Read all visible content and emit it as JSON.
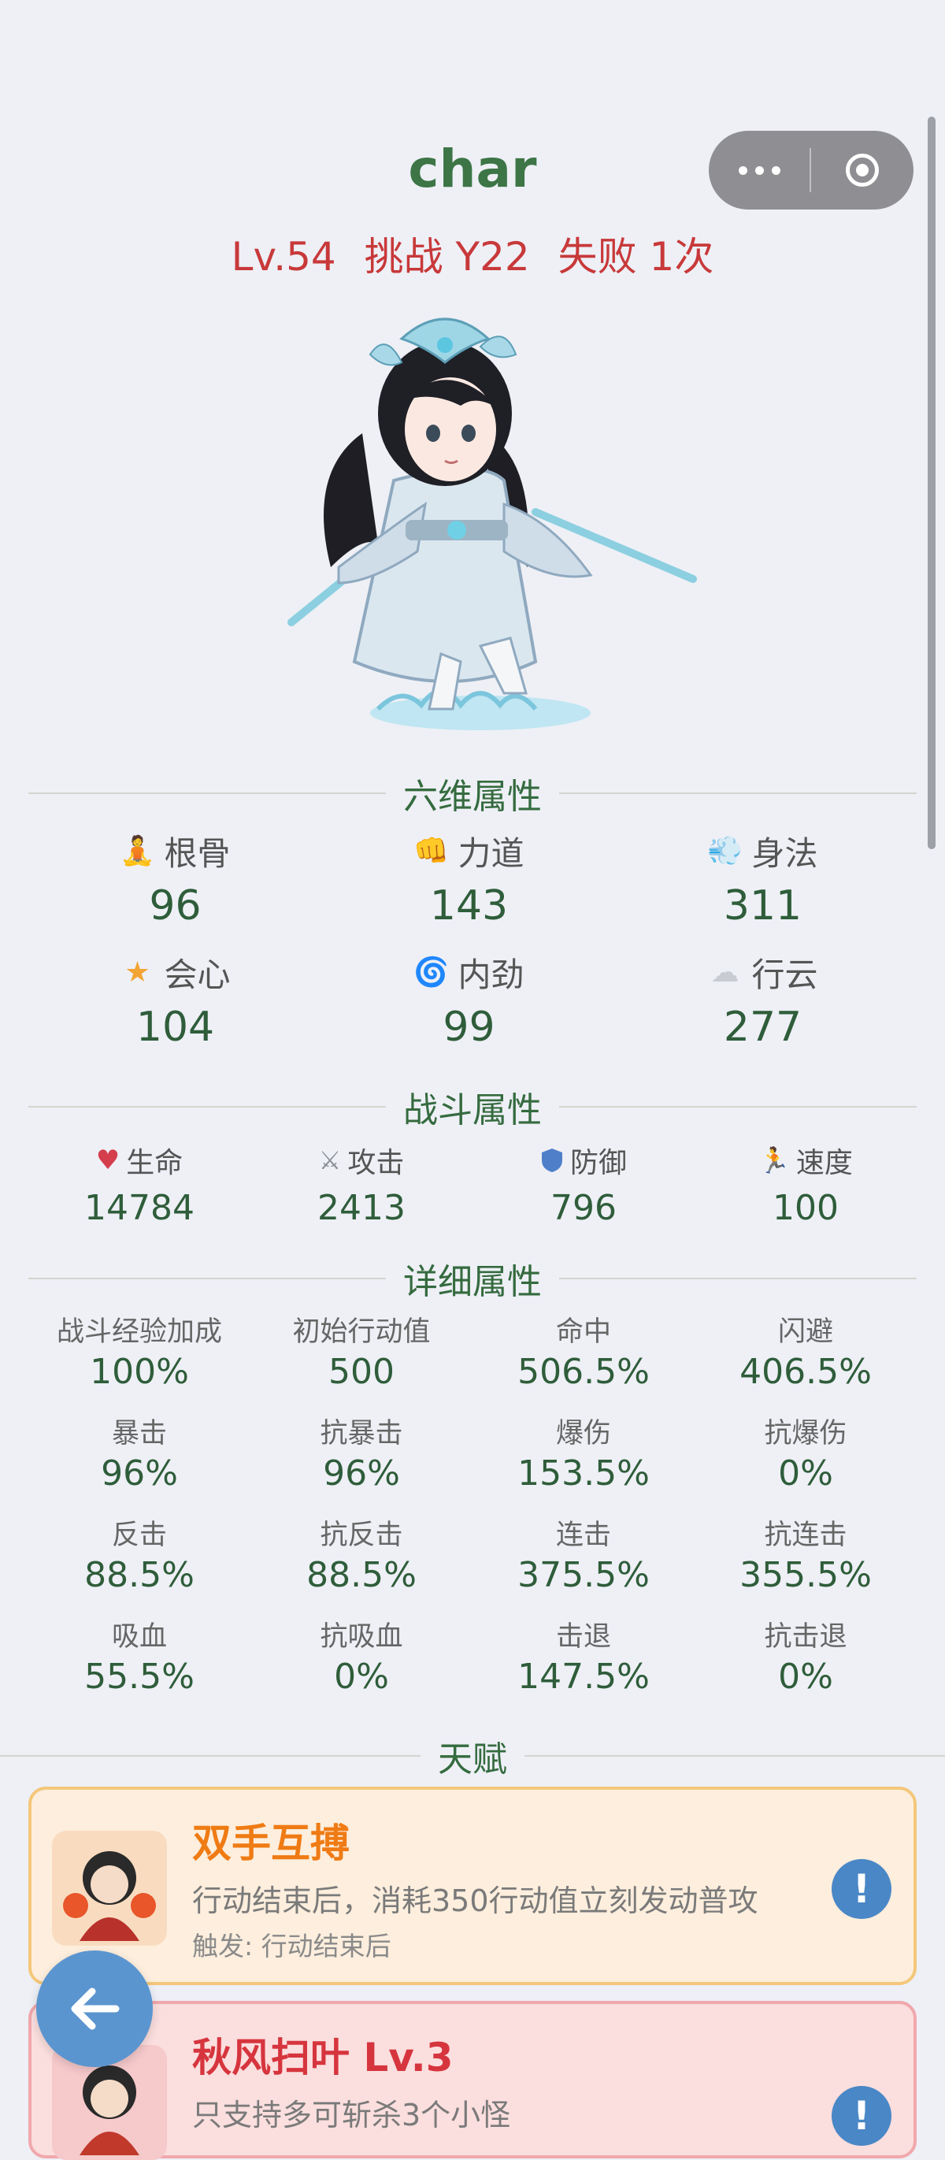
{
  "capsule": {
    "more_icon": "more-dots-icon",
    "close_icon": "target-close-icon"
  },
  "character": {
    "name": "char",
    "level": "Lv.54",
    "challenge": "挑战 Y22",
    "failures": "失败 1次"
  },
  "six_dim": {
    "title": "六维属性",
    "items": [
      {
        "label": "根骨",
        "value": "96",
        "icon": "meditation-icon"
      },
      {
        "label": "力道",
        "value": "143",
        "icon": "fist-icon"
      },
      {
        "label": "身法",
        "value": "311",
        "icon": "wind-icon"
      },
      {
        "label": "会心",
        "value": "104",
        "icon": "star-icon"
      },
      {
        "label": "内劲",
        "value": "99",
        "icon": "swirl-icon"
      },
      {
        "label": "行云",
        "value": "277",
        "icon": "cloud-icon"
      }
    ]
  },
  "battle": {
    "title": "战斗属性",
    "items": [
      {
        "label": "生命",
        "value": "14784",
        "icon": "heart-icon"
      },
      {
        "label": "攻击",
        "value": "2413",
        "icon": "crossed-swords-icon"
      },
      {
        "label": "防御",
        "value": "796",
        "icon": "shield-icon"
      },
      {
        "label": "速度",
        "value": "100",
        "icon": "runner-icon"
      }
    ]
  },
  "detail": {
    "title": "详细属性",
    "items": [
      {
        "label": "战斗经验加成",
        "value": "100%"
      },
      {
        "label": "初始行动值",
        "value": "500"
      },
      {
        "label": "命中",
        "value": "506.5%"
      },
      {
        "label": "闪避",
        "value": "406.5%"
      },
      {
        "label": "暴击",
        "value": "96%"
      },
      {
        "label": "抗暴击",
        "value": "96%"
      },
      {
        "label": "爆伤",
        "value": "153.5%"
      },
      {
        "label": "抗爆伤",
        "value": "0%"
      },
      {
        "label": "反击",
        "value": "88.5%"
      },
      {
        "label": "抗反击",
        "value": "88.5%"
      },
      {
        "label": "连击",
        "value": "375.5%"
      },
      {
        "label": "抗连击",
        "value": "355.5%"
      },
      {
        "label": "吸血",
        "value": "55.5%"
      },
      {
        "label": "抗吸血",
        "value": "0%"
      },
      {
        "label": "击退",
        "value": "147.5%"
      },
      {
        "label": "抗击退",
        "value": "0%"
      }
    ]
  },
  "talent": {
    "title": "天赋",
    "cards": [
      {
        "title": "双手互搏",
        "desc": "行动结束后，消耗350行动值立刻发动普攻",
        "trigger": "触发: 行动结束后",
        "info": "!"
      },
      {
        "title": "秋风扫叶 Lv.3",
        "desc": "只支持多可斩杀3个小怪",
        "info": "!"
      }
    ]
  },
  "colors": {
    "accent_green": "#3d7546",
    "level_red": "#c8393a",
    "talent_orange": "#ef7b14",
    "talent_red": "#d6353e",
    "info_blue": "#4a87c6"
  }
}
